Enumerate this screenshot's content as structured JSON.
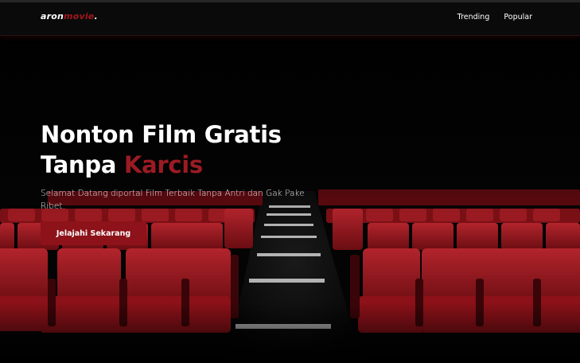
{
  "brand": {
    "name": "aron",
    "accent": "movie",
    "dot": "."
  },
  "nav": {
    "links": [
      "Trending",
      "Popular"
    ]
  },
  "hero": {
    "title_line1": "Nonton Film Gratis",
    "title_line2_plain": "Tanpa ",
    "title_line2_accent": "Karcis",
    "subtitle": "Selamat Datang diportal Film Terbaik Tanpa Antri dan Gak Pake Ribet.",
    "cta_label": "Jelajahi Sekarang"
  },
  "colors": {
    "accent": "#9b1b22",
    "background": "#000000",
    "button": "#8d1219"
  }
}
